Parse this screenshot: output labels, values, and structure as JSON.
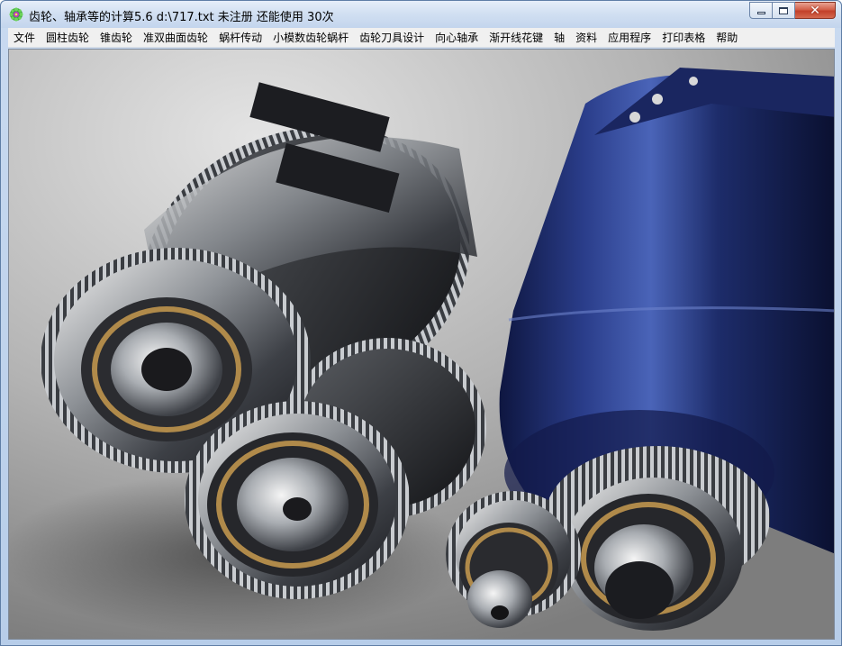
{
  "window": {
    "title": "齿轮、轴承等的计算5.6    d:\\717.txt 未注册 还能使用 30次",
    "minimize_symbol": "",
    "maximize_symbol": "",
    "close_symbol": "✕"
  },
  "menubar": {
    "items": [
      "文件",
      "圆柱齿轮",
      "锥齿轮",
      "准双曲面齿轮",
      "蜗杆传动",
      "小模数齿轮蜗杆",
      "齿轮刀具设计",
      "向心轴承",
      "渐开线花键",
      "轴",
      "资料",
      "应用程序",
      "打印表格",
      "帮助"
    ]
  },
  "icons": {
    "app": "gear-flower-icon",
    "minimize": "minimize-icon",
    "maximize": "maximize-icon",
    "close": "close-icon"
  },
  "colors": {
    "titlebar": "#d2e0f2",
    "menubar": "#f0f0f0",
    "motor_blue": "#1f2f6b",
    "gear_metal": "#9aa0a6",
    "bearing_bronze": "#b08a4a",
    "close_red": "#c7452e"
  },
  "content": {
    "splash_image": "gears-and-motor-render"
  }
}
